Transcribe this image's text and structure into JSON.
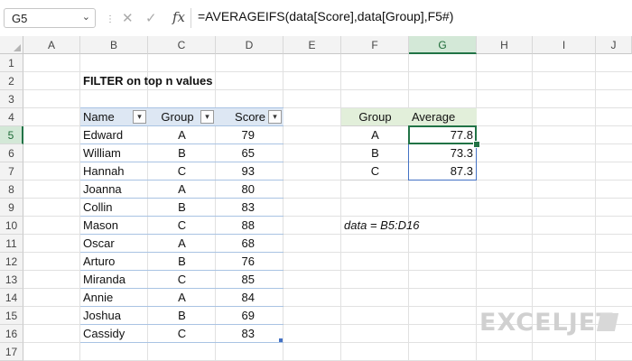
{
  "formula_bar": {
    "name_box": "G5",
    "formula": "=AVERAGEIFS(data[Score],data[Group],F5#)"
  },
  "columns": [
    "A",
    "B",
    "C",
    "D",
    "E",
    "F",
    "G",
    "H",
    "I",
    "J"
  ],
  "rows": [
    "1",
    "2",
    "3",
    "4",
    "5",
    "6",
    "7",
    "8",
    "9",
    "10",
    "11",
    "12",
    "13",
    "14",
    "15",
    "16",
    "17"
  ],
  "selected_cell": {
    "column": "G",
    "row": "5"
  },
  "sheet_title": "FILTER on top n values",
  "data_table": {
    "headers": [
      "Name",
      "Group",
      "Score"
    ],
    "rows": [
      [
        "Edward",
        "A",
        "79"
      ],
      [
        "William",
        "B",
        "65"
      ],
      [
        "Hannah",
        "C",
        "93"
      ],
      [
        "Joanna",
        "A",
        "80"
      ],
      [
        "Collin",
        "B",
        "83"
      ],
      [
        "Mason",
        "C",
        "88"
      ],
      [
        "Oscar",
        "A",
        "68"
      ],
      [
        "Arturo",
        "B",
        "76"
      ],
      [
        "Miranda",
        "C",
        "85"
      ],
      [
        "Annie",
        "A",
        "84"
      ],
      [
        "Joshua",
        "B",
        "69"
      ],
      [
        "Cassidy",
        "C",
        "83"
      ]
    ]
  },
  "summary_table": {
    "headers": [
      "Group",
      "Average"
    ],
    "rows": [
      [
        "A",
        "77.8"
      ],
      [
        "B",
        "73.3"
      ],
      [
        "C",
        "87.3"
      ]
    ]
  },
  "note": "data = B5:D16",
  "logo": "EXCELJET",
  "colors": {
    "accent_green": "#217346",
    "table_header_blue": "#dde7f3",
    "summary_header_green": "#e2efda"
  },
  "icons": [
    "chevron-down-icon",
    "cancel-icon",
    "check-icon",
    "function-icon",
    "filter-dropdown-icon"
  ]
}
